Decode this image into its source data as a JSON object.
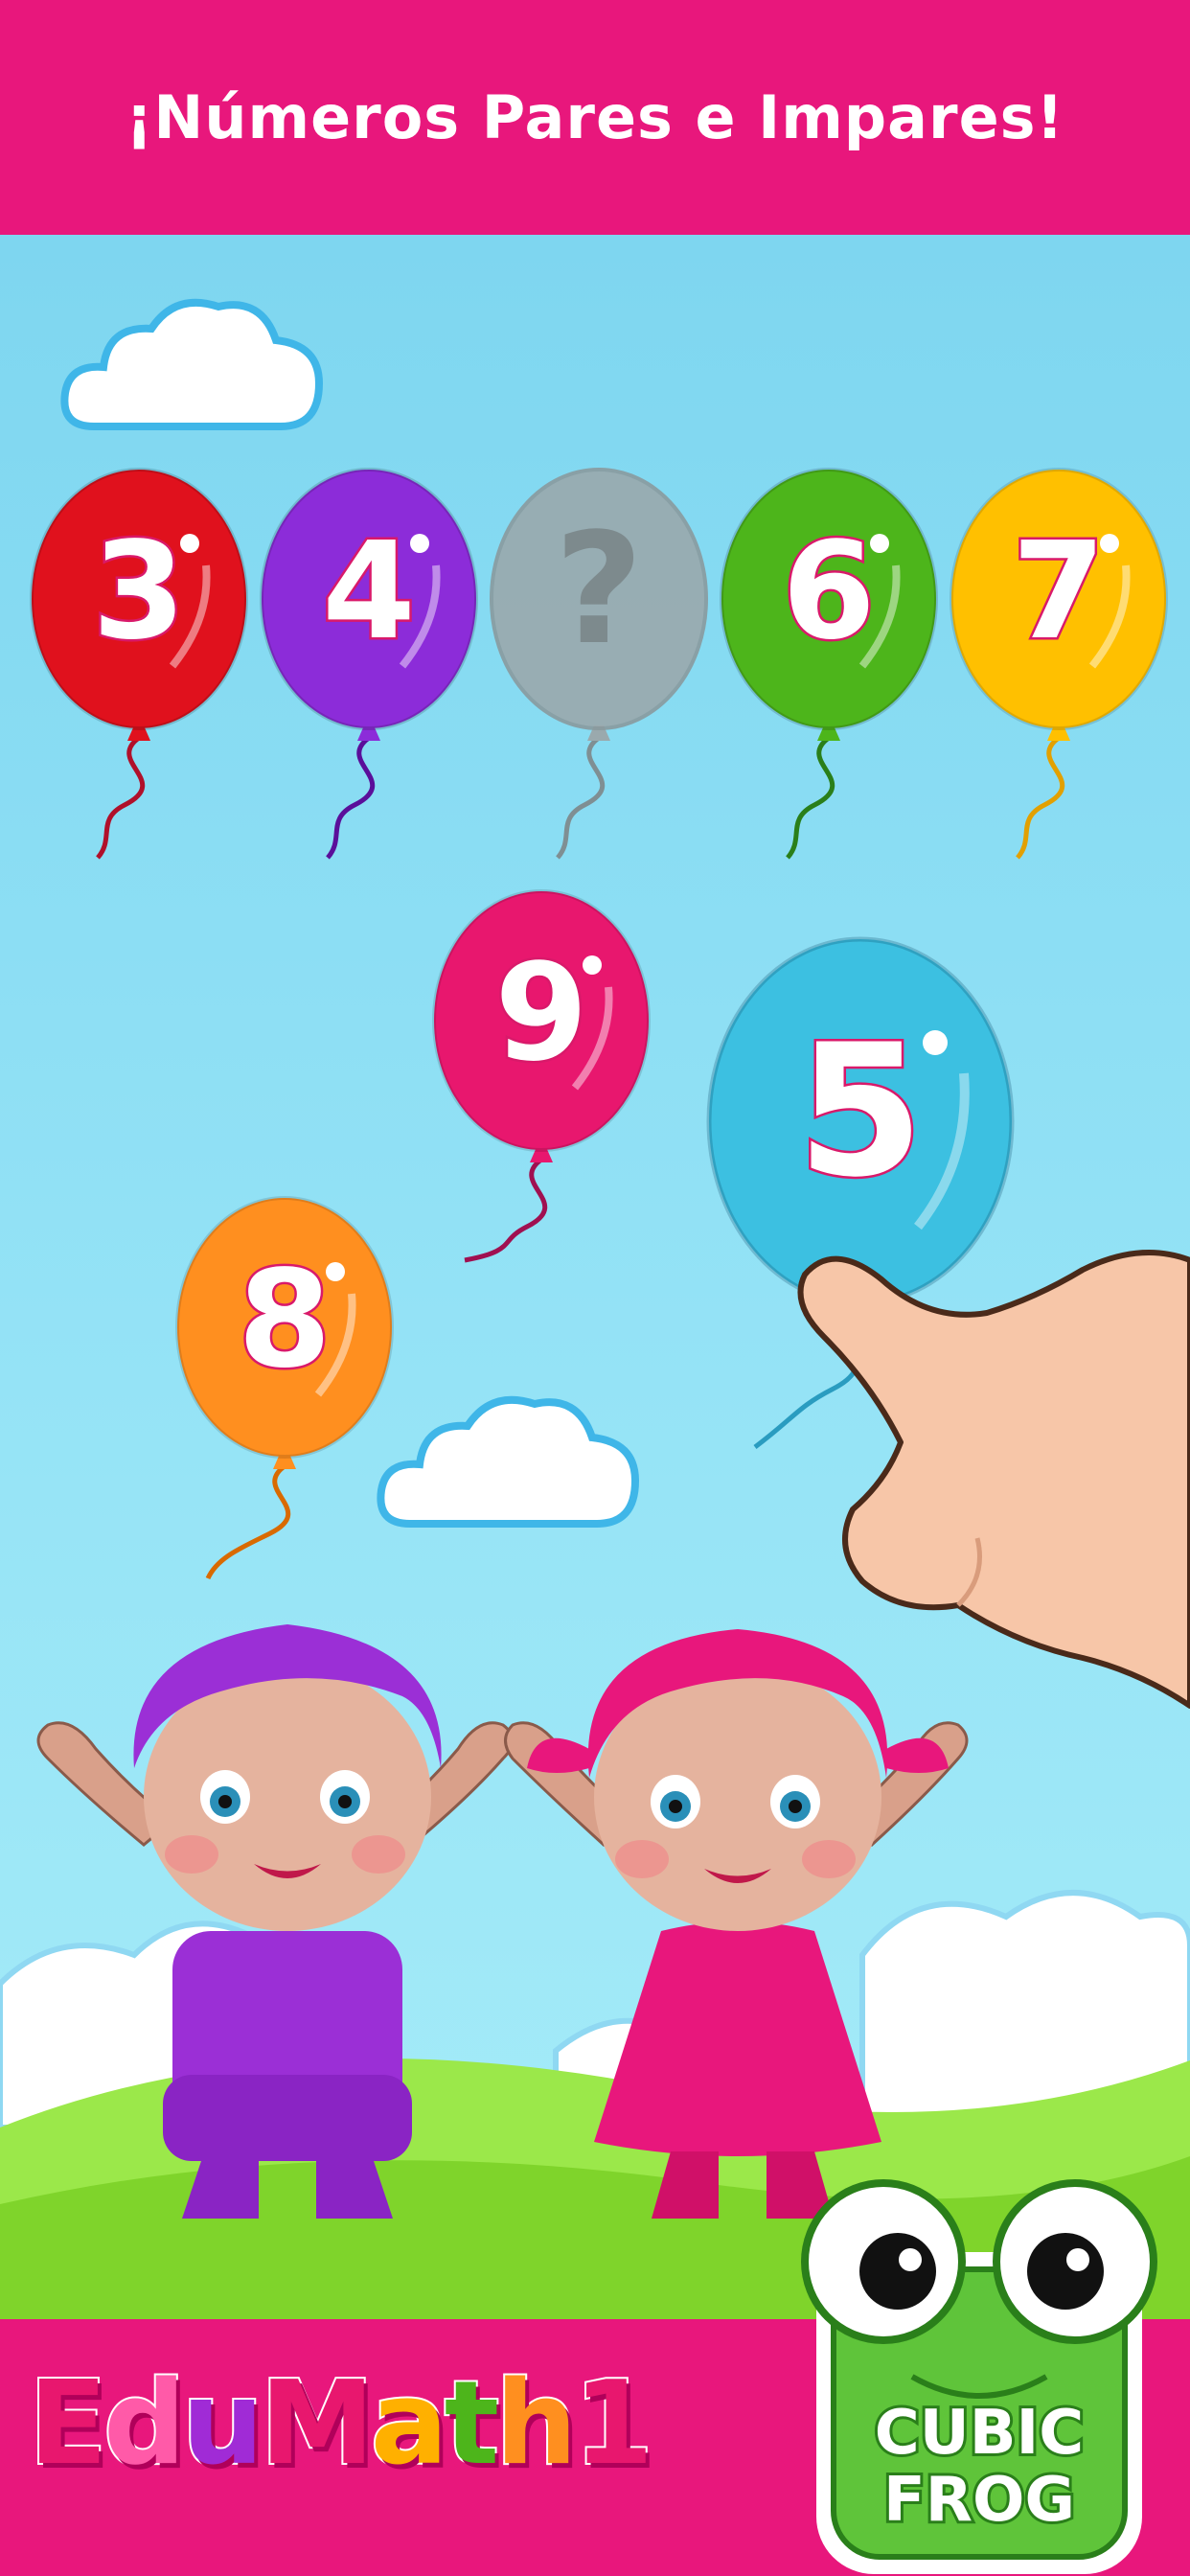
{
  "header": {
    "title": "¡Números Pares e Impares!"
  },
  "sequence": [
    {
      "label": "3",
      "color": "#e0111d"
    },
    {
      "label": "4",
      "color": "#8c2cd9"
    },
    {
      "label": "?",
      "color": "#9aa9ad"
    },
    {
      "label": "6",
      "color": "#4db51b"
    },
    {
      "label": "7",
      "color": "#ffc000"
    }
  ],
  "options": [
    {
      "label": "9",
      "color": "#e8176e"
    },
    {
      "label": "5",
      "color": "#38bfe0"
    },
    {
      "label": "8",
      "color": "#ff8f1f"
    }
  ],
  "footer": {
    "logo_letters": [
      {
        "ch": "E",
        "color": "#e8176e"
      },
      {
        "ch": "d",
        "color": "#ff5aa8"
      },
      {
        "ch": "u",
        "color": "#a02bd6"
      },
      {
        "ch": "M",
        "color": "#e8176e"
      },
      {
        "ch": "a",
        "color": "#ffb000"
      },
      {
        "ch": "t",
        "color": "#4db51b"
      },
      {
        "ch": "h",
        "color": "#ff8f1f"
      },
      {
        "ch": "1",
        "color": "#e8176e"
      }
    ],
    "brand_line1": "CUBIC",
    "brand_line2": "FROG"
  }
}
